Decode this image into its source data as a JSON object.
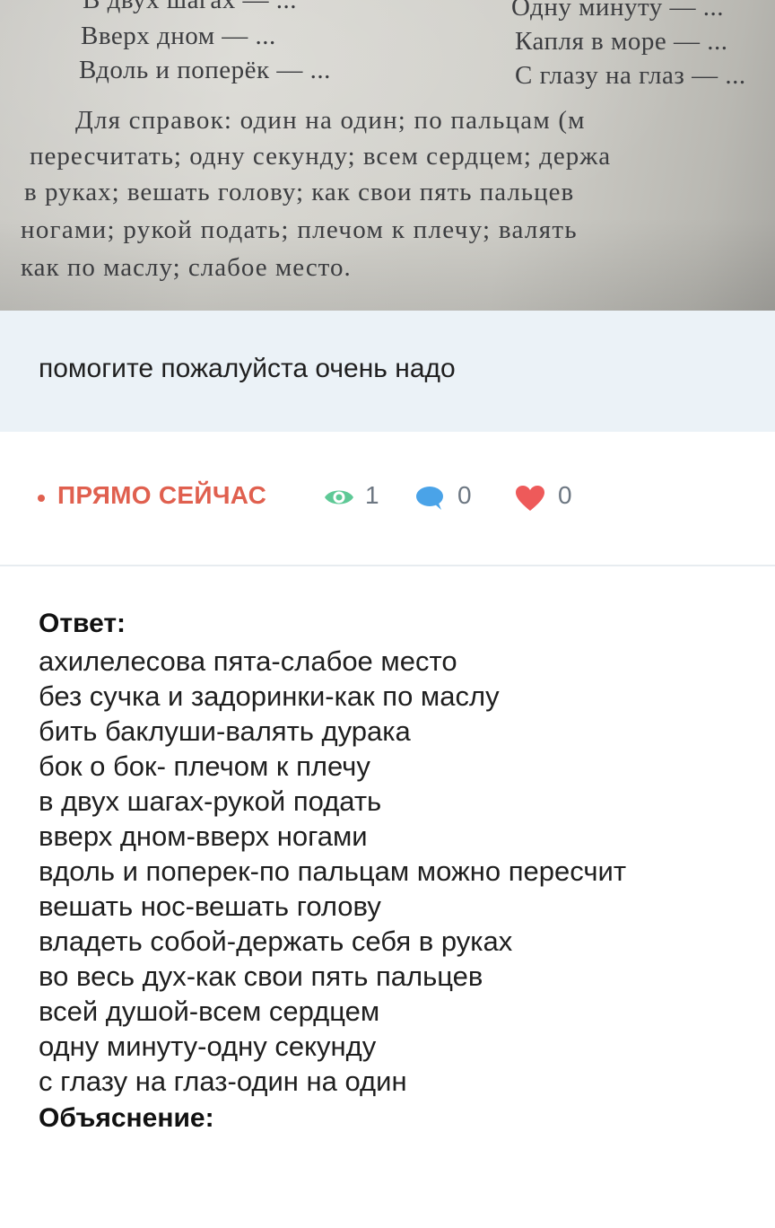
{
  "photo": {
    "lines": [
      "В двух шагах — ...",
      "Одну минуту — ...",
      "Вверх дном — ...",
      "Капля в море — ...",
      "Вдоль и поперёк — ...",
      "С глазу на глаз — ...",
      "Для справок: один на один; по пальцам (м",
      "пересчитать; одну секунду; всем сердцем; держа",
      "в руках; вешать голову; как свои пять пальцев",
      "ногами; рукой подать; плечом к плечу; валять",
      "как по маслу; слабое место."
    ]
  },
  "question": {
    "text": "помогите пожалуйста очень надо"
  },
  "meta": {
    "live_label": "ПРЯМО СЕЙЧАС",
    "views": "1",
    "comments": "0",
    "likes": "0",
    "colors": {
      "live": "#e0604f",
      "views_icon": "#5ec996",
      "comments_icon": "#4aa3e8",
      "likes_icon": "#ee5a5a"
    },
    "icons": [
      "eye-icon",
      "comment-icon",
      "heart-icon"
    ]
  },
  "answer": {
    "title": "Ответ:",
    "lines": [
      "ахилелесова пята-слабое место",
      "без сучка и задоринки-как по маслу",
      "бить баклуши-валять дурака",
      "бок о бок- плечом к плечу",
      "в двух шагах-рукой подать",
      "вверх дном-вверх ногами",
      "вдоль и поперек-по пальцам можно пересчит",
      "вешать нос-вешать голову",
      "владеть собой-держать себя в руках",
      "во весь дух-как свои пять пальцев",
      "всей душой-всем сердцем",
      "одну минуту-одну секунду",
      "с глазу на глаз-один на один"
    ],
    "explanation_title": "Объяснение:"
  }
}
